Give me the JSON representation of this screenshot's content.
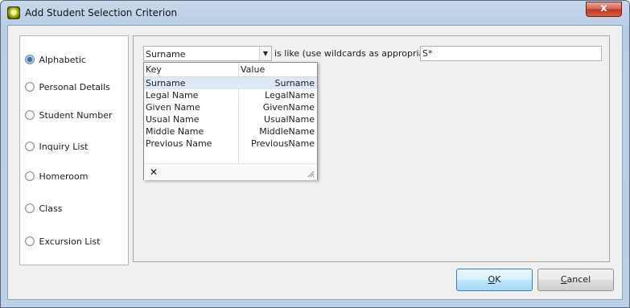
{
  "window": {
    "title": "Add Student Selection Criterion",
    "close_glyph": "x",
    "app_icon": "app-logo-icon"
  },
  "criteria": {
    "selected": "Alphabetic",
    "options": [
      {
        "label": "Alphabetic"
      },
      {
        "label": "Personal Details"
      },
      {
        "label": "Student Number"
      },
      {
        "label": "Inquiry List"
      },
      {
        "label": "Homeroom"
      },
      {
        "label": "Class"
      },
      {
        "label": "Excursion List"
      }
    ]
  },
  "filter": {
    "field_value": "Surname",
    "like_label": "is like (use wildcards as appropriate):",
    "pattern_value": "S*"
  },
  "dropdown": {
    "key_header": "Key",
    "value_header": "Value",
    "rows": [
      {
        "key": "Surname",
        "value": "Surname"
      },
      {
        "key": "Legal Name",
        "value": "LegalName"
      },
      {
        "key": "Given Name",
        "value": "GivenName"
      },
      {
        "key": "Usual Name",
        "value": "UsualName"
      },
      {
        "key": "Middle Name",
        "value": "MiddleName"
      },
      {
        "key": "Previous Name",
        "value": "PreviousName"
      }
    ],
    "clear_glyph": "✕"
  },
  "buttons": {
    "ok": {
      "mnemonic": "O",
      "rest": "K"
    },
    "cancel": {
      "mnemonic": "C",
      "rest": "ancel"
    }
  },
  "colors": {
    "titlebar": "#bcd0e6",
    "close_button": "#c1391d",
    "selected_row": "#dfe8f5",
    "default_button_border": "#3c7fb1"
  }
}
